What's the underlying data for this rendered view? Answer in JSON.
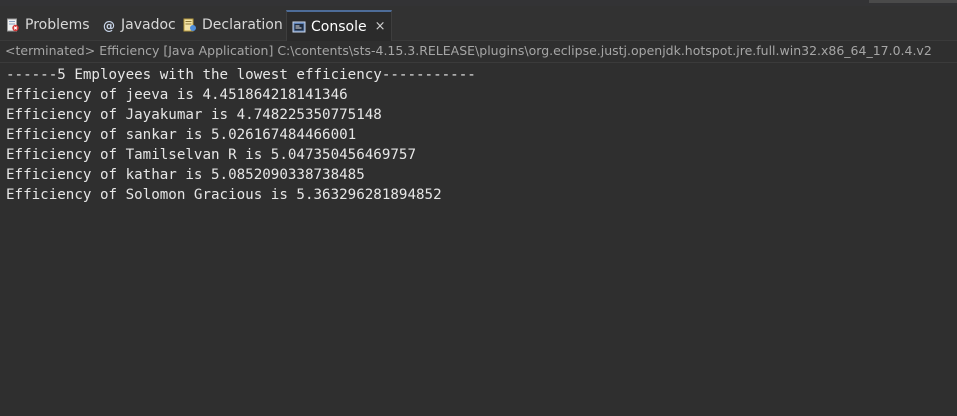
{
  "tabs": {
    "problems": "Problems",
    "javadoc": "Javadoc",
    "declaration": "Declaration",
    "console": "Console",
    "console_close": "×"
  },
  "status": "<terminated> Efficiency [Java Application] C:\\contents\\sts-4.15.3.RELEASE\\plugins\\org.eclipse.justj.openjdk.hotspot.jre.full.win32.x86_64_17.0.4.v2",
  "console": {
    "lines": [
      "------5 Employees with the lowest efficiency-----------",
      "Efficiency of jeeva is 4.451864218141346",
      "Efficiency of Jayakumar is 4.748225350775148",
      "Efficiency of sankar is 5.026167484466001",
      "Efficiency of Tamilselvan R is 5.047350456469757",
      "Efficiency of kathar is 5.0852090338738485",
      "Efficiency of Solomon Gracious is 5.363296281894852"
    ]
  },
  "colors": {
    "background": "#2f2f2f",
    "text": "#e6e6e6",
    "active_tab_accent": "#4d6c98"
  },
  "icons": {
    "problems": "problems-icon",
    "javadoc": "javadoc-icon",
    "declaration": "declaration-icon",
    "console": "console-icon"
  }
}
